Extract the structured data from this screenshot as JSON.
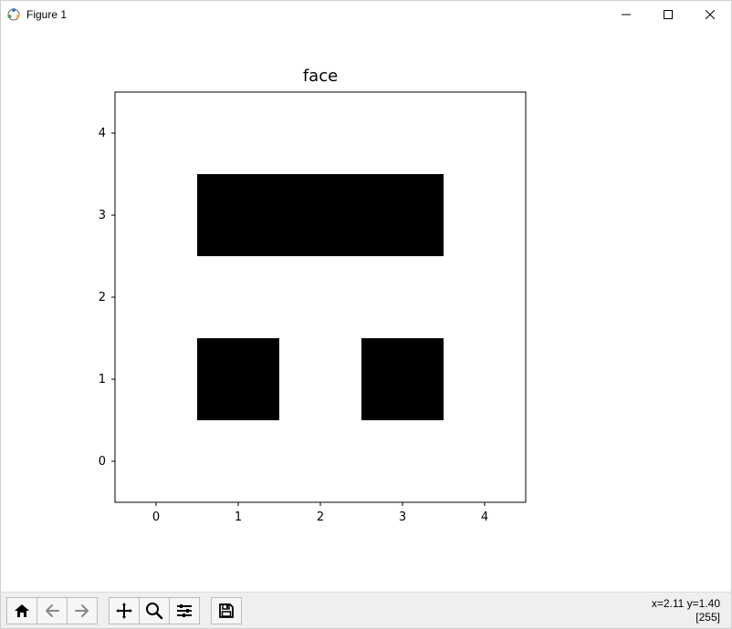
{
  "window": {
    "title": "Figure 1"
  },
  "chart_data": {
    "type": "heatmap",
    "title": "face",
    "xlabel": "",
    "ylabel": "",
    "xlim": [
      -0.5,
      4.5
    ],
    "ylim": [
      4.5,
      -0.5
    ],
    "xticks": [
      0,
      1,
      2,
      3,
      4
    ],
    "yticks": [
      0,
      1,
      2,
      3,
      4
    ],
    "data": [
      [
        255,
        255,
        255,
        255,
        255
      ],
      [
        255,
        0,
        255,
        0,
        255
      ],
      [
        255,
        255,
        255,
        255,
        255
      ],
      [
        255,
        0,
        0,
        0,
        255
      ],
      [
        255,
        255,
        255,
        255,
        255
      ]
    ],
    "cmap": "gray",
    "vmin": 0,
    "vmax": 255
  },
  "axes": {
    "x_tick_labels": [
      "0",
      "1",
      "2",
      "3",
      "4"
    ],
    "y_tick_labels": [
      "0",
      "1",
      "2",
      "3",
      "4"
    ]
  },
  "toolbar": {
    "home": "Home",
    "back": "Back",
    "forward": "Forward",
    "pan": "Pan",
    "zoom": "Zoom",
    "subplots": "Configure subplots",
    "save": "Save"
  },
  "status": {
    "coords": "x=2.11 y=1.40",
    "value": "[255]"
  }
}
